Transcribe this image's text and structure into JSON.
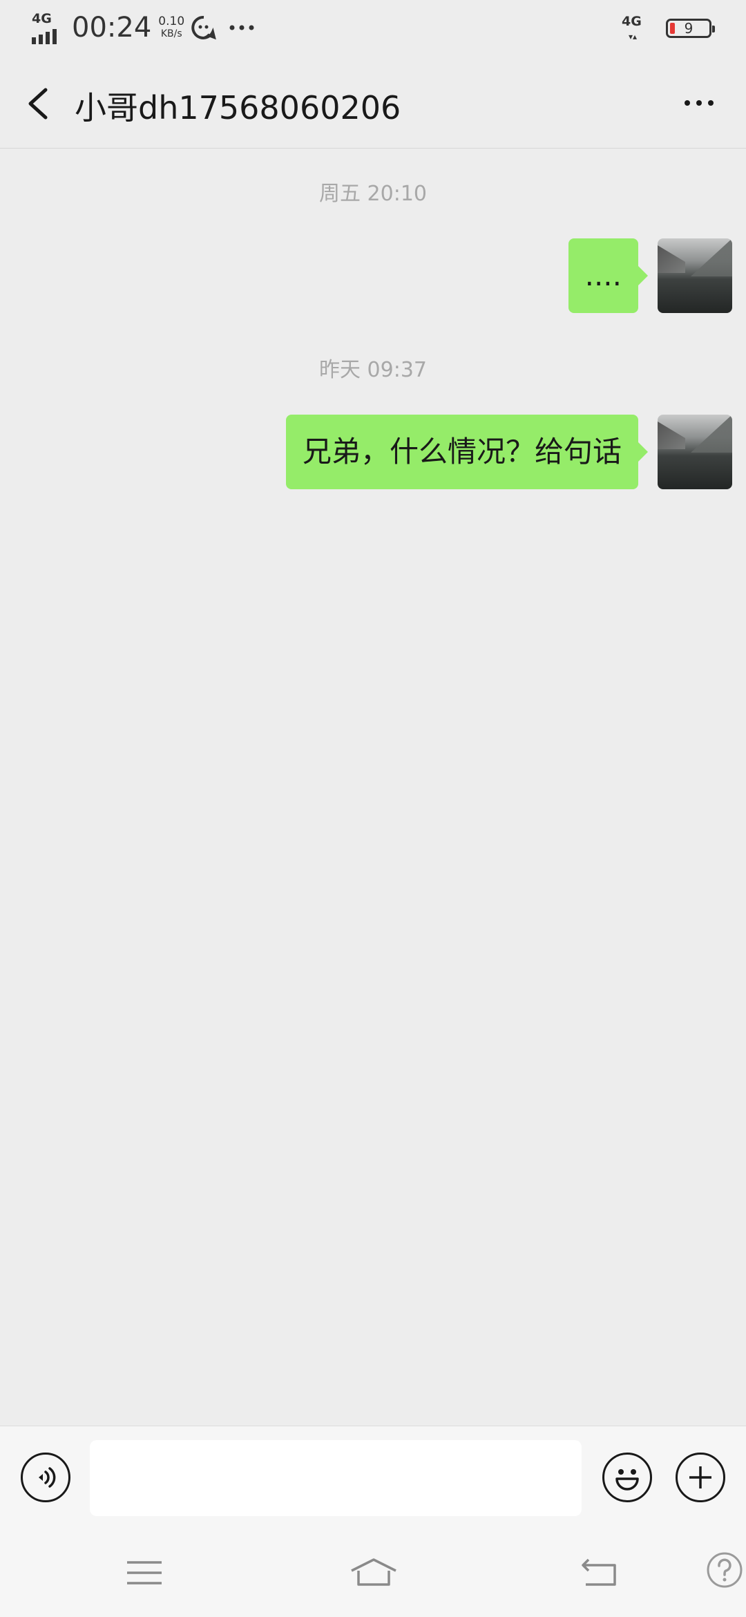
{
  "status_bar": {
    "network_left": "4G",
    "time": "00:24",
    "speed_value": "0.10",
    "speed_unit": "KB/s",
    "network_right": "4G",
    "battery_level": "9"
  },
  "header": {
    "title": "小哥dh17568060206"
  },
  "chat": {
    "messages": [
      {
        "timestamp": "周五 20:10",
        "text": "....",
        "sender": "self"
      },
      {
        "timestamp": "昨天 09:37",
        "text": "兄弟，什么情况？给句话",
        "sender": "self"
      }
    ]
  },
  "input": {
    "value": "",
    "placeholder": ""
  },
  "colors": {
    "bubble_self": "#95ec69",
    "background": "#ededed",
    "battery_low": "#e53935"
  },
  "icons": {
    "back": "chevron-left-icon",
    "more": "more-dots-icon",
    "voice": "voice-icon",
    "emoji": "emoji-icon",
    "plus": "plus-icon",
    "nav_menu": "menu-icon",
    "nav_home": "home-icon",
    "nav_back": "return-icon",
    "help": "help-icon"
  }
}
